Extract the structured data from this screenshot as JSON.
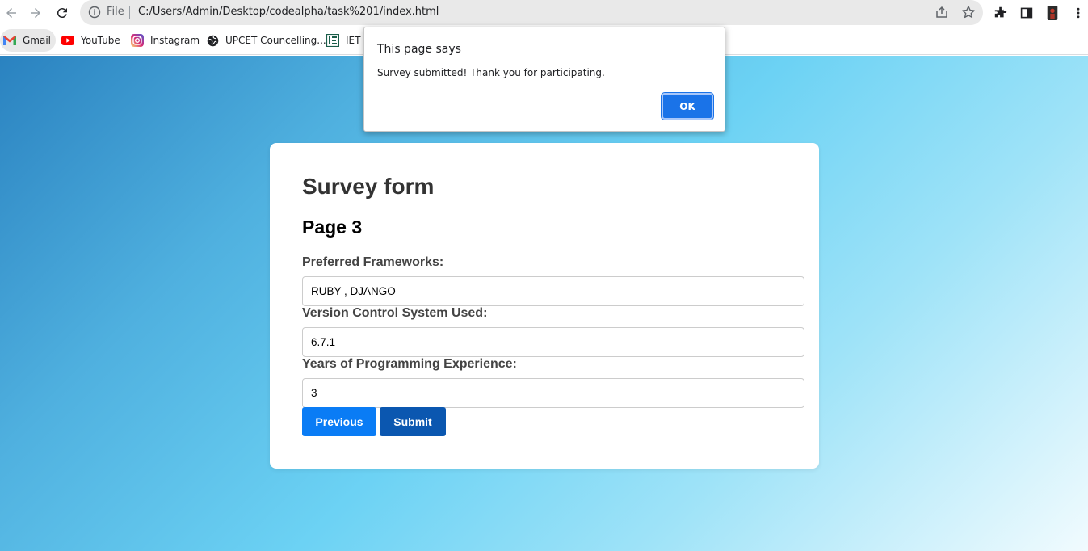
{
  "browser": {
    "scheme_label": "File",
    "url": "C:/Users/Admin/Desktop/codealpha/task%201/index.html",
    "icons": [
      "back-arrow-icon",
      "forward-arrow-icon",
      "reload-icon",
      "info-icon",
      "share-icon",
      "star-icon",
      "extensions-icon",
      "side-panel-icon",
      "profile-avatar",
      "kebab-menu-icon"
    ]
  },
  "bookmarks": [
    {
      "label": "Gmail",
      "icon": "gmail-icon"
    },
    {
      "label": "YouTube",
      "icon": "youtube-icon"
    },
    {
      "label": "Instagram",
      "icon": "instagram-icon"
    },
    {
      "label": "UPCET Councelling...",
      "icon": "globe-icon"
    },
    {
      "label": "IET L",
      "icon": "iet-icon"
    }
  ],
  "dialog": {
    "title": "This page says",
    "message": "Survey submitted! Thank you for participating.",
    "ok_label": "OK"
  },
  "form": {
    "title": "Survey form",
    "page_title": "Page 3",
    "fields": [
      {
        "label": "Preferred Frameworks:",
        "value": "RUBY , DJANGO"
      },
      {
        "label": "Version Control System Used:",
        "value": "6.7.1"
      },
      {
        "label": "Years of Programming Experience:",
        "value": "3"
      }
    ],
    "previous_label": "Previous",
    "submit_label": "Submit"
  },
  "colors": {
    "primary_button": "#0a7cf5",
    "submit_button": "#0b57b0",
    "dialog_ok": "#1a73e8"
  }
}
